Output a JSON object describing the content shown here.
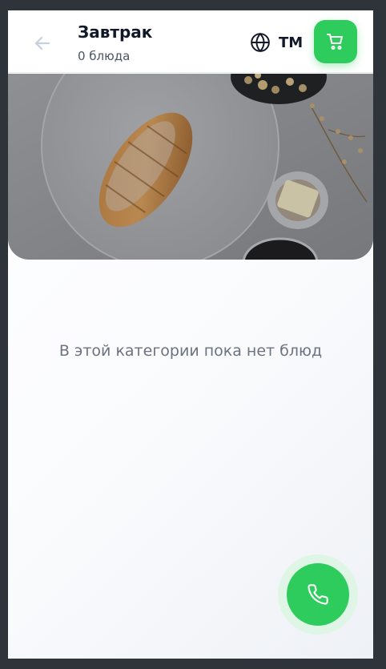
{
  "header": {
    "title": "Завтрак",
    "subtitle": "0 блюда",
    "language_code": "TM"
  },
  "icons": {
    "back": "arrow-left-icon",
    "language": "globe-icon",
    "cart": "shopping-cart-icon",
    "call": "phone-icon"
  },
  "hero": {
    "image": "croissant-breakfast-photo"
  },
  "main": {
    "empty_message": "В этой категории пока нет блюд"
  },
  "colors": {
    "accent": "#2ecc5c",
    "accent_soft": "#dff6e6",
    "text_dark": "#111827",
    "text_muted": "#6b7280",
    "outer_background": "#2f333a"
  }
}
